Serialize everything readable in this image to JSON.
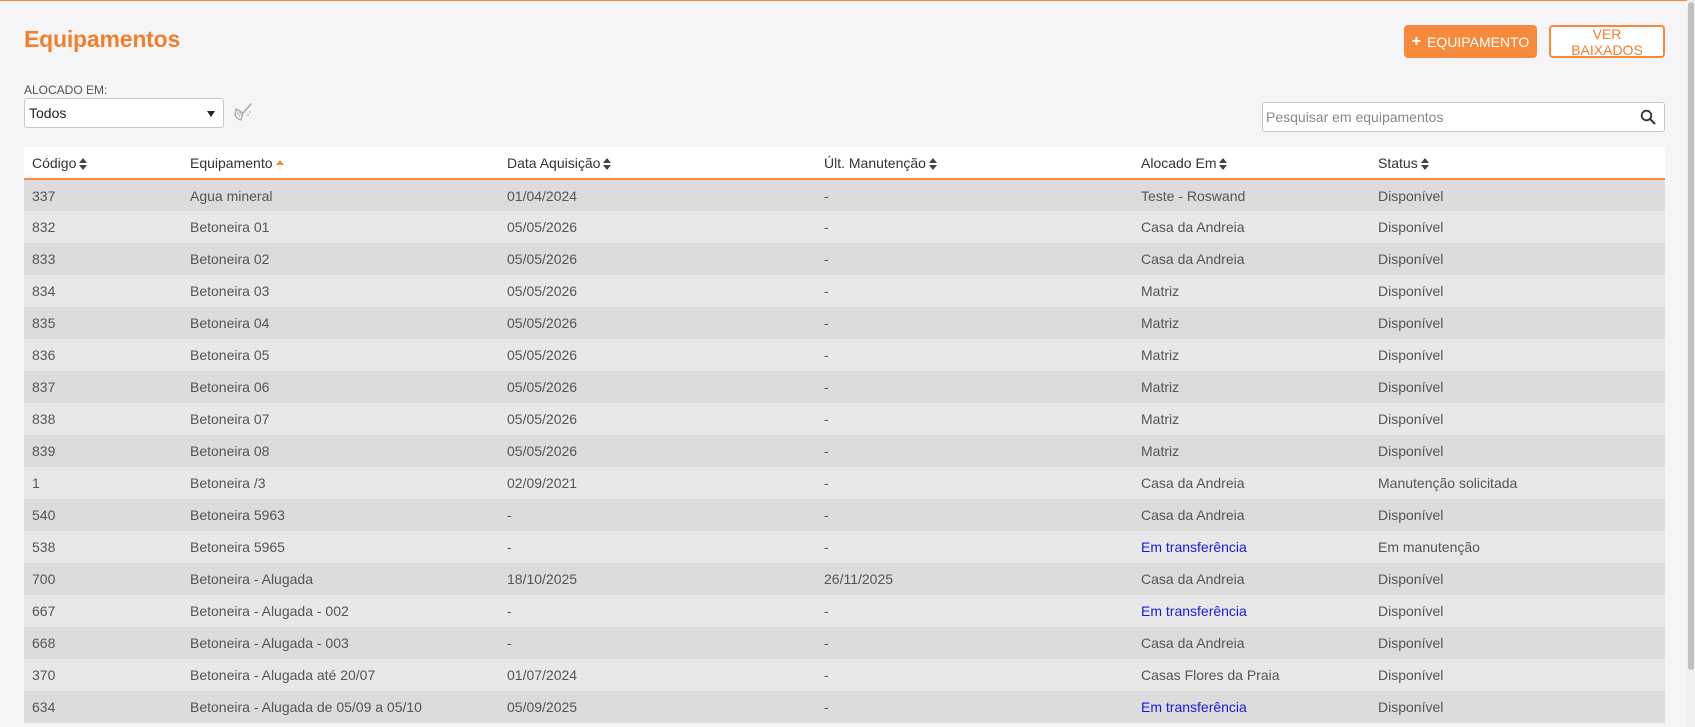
{
  "page": {
    "title": "Equipamentos",
    "add_button": "EQUIPAMENTO",
    "view_button": "VER BAIXADOS"
  },
  "filter": {
    "label": "ALOCADO EM:",
    "selected": "Todos"
  },
  "search": {
    "placeholder": "Pesquisar em equipamentos",
    "value": ""
  },
  "colors": {
    "accent": "#f58a3d",
    "link": "#1a1ad6"
  },
  "table": {
    "columns": [
      "Código",
      "Equipamento",
      "Data Aquisição",
      "Últ. Manutenção",
      "Alocado Em",
      "Status"
    ],
    "sorted_by": "Equipamento",
    "sort_direction": "asc",
    "rows": [
      [
        "337",
        "Agua mineral",
        "01/04/2024",
        "-",
        "Teste - Roswand",
        "Disponível"
      ],
      [
        "832",
        "Betoneira 01",
        "05/05/2026",
        "-",
        "Casa da Andreia",
        "Disponível"
      ],
      [
        "833",
        "Betoneira 02",
        "05/05/2026",
        "-",
        "Casa da Andreia",
        "Disponível"
      ],
      [
        "834",
        "Betoneira 03",
        "05/05/2026",
        "-",
        "Matriz",
        "Disponível"
      ],
      [
        "835",
        "Betoneira 04",
        "05/05/2026",
        "-",
        "Matriz",
        "Disponível"
      ],
      [
        "836",
        "Betoneira 05",
        "05/05/2026",
        "-",
        "Matriz",
        "Disponível"
      ],
      [
        "837",
        "Betoneira 06",
        "05/05/2026",
        "-",
        "Matriz",
        "Disponível"
      ],
      [
        "838",
        "Betoneira 07",
        "05/05/2026",
        "-",
        "Matriz",
        "Disponível"
      ],
      [
        "839",
        "Betoneira 08",
        "05/05/2026",
        "-",
        "Matriz",
        "Disponível"
      ],
      [
        "1",
        "Betoneira /3",
        "02/09/2021",
        "-",
        "Casa da Andreia",
        "Manutenção solicitada"
      ],
      [
        "540",
        "Betoneira 5963",
        "-",
        "-",
        "Casa da Andreia",
        "Disponível"
      ],
      [
        "538",
        "Betoneira 5965",
        "-",
        "-",
        "Em transferência",
        "Em manutenção"
      ],
      [
        "700",
        "Betoneira - Alugada",
        "18/10/2025",
        "26/11/2025",
        "Casa da Andreia",
        "Disponível"
      ],
      [
        "667",
        "Betoneira - Alugada - 002",
        "-",
        "-",
        "Em transferência",
        "Disponível"
      ],
      [
        "668",
        "Betoneira - Alugada - 003",
        "-",
        "-",
        "Casa da Andreia",
        "Disponível"
      ],
      [
        "370",
        "Betoneira - Alugada até 20/07",
        "01/07/2024",
        "-",
        "Casas Flores da Praia",
        "Disponível"
      ],
      [
        "634",
        "Betoneira - Alugada de 05/09 a 05/10",
        "05/09/2025",
        "-",
        "Em transferência",
        "Disponível"
      ]
    ]
  }
}
